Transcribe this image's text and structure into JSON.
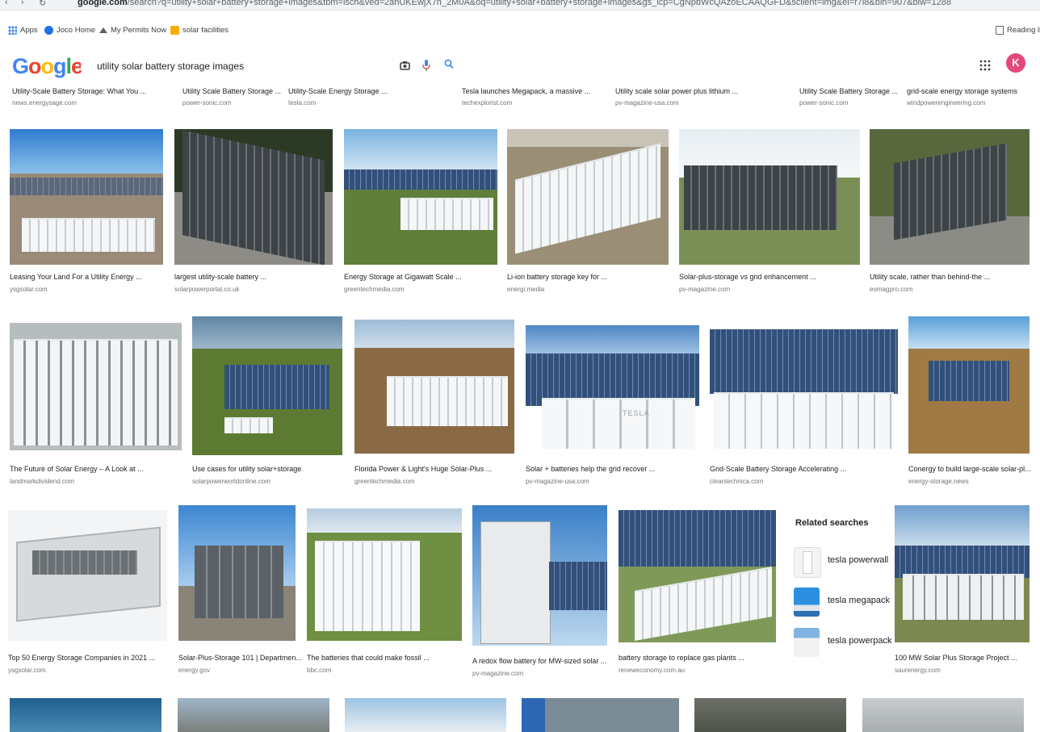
{
  "browser": {
    "url_domain": "google.com",
    "url_rest": "/search?q=utility+solar+battery+storage+images&tbm=isch&ved=2ahUKEwjX7h_2M0A&oq=utility+solar+battery+storage+images&gs_lcp=CgNpbWcQAzoECAAQGFD&sclient=img&ei=r7i8&bih=907&biw=1288",
    "back": "‹",
    "forward": "›",
    "reload": "↻"
  },
  "bookmarks": [
    {
      "label": "Apps",
      "color": "#4285f4"
    },
    {
      "label": "Joco Home",
      "color": "#1a73e8"
    },
    {
      "label": "My Permits Now",
      "color": "#5f6368"
    },
    {
      "label": "solar facilities",
      "color": "#f9ab00"
    }
  ],
  "reading_list": "Reading li",
  "search": {
    "logo_letters": [
      "G",
      "o",
      "o",
      "g",
      "l",
      "e"
    ],
    "logo_colors": [
      "#4285f4",
      "#ea4335",
      "#fbbc05",
      "#4285f4",
      "#34a853",
      "#ea4335"
    ],
    "query": "utility solar battery storage images"
  },
  "user_initial": "K",
  "top_row": [
    {
      "caption": "Utility-Scale Battery Storage: What You ...",
      "source": "news.energysage.com"
    },
    {
      "caption": "Utility Scale Battery Storage ...",
      "source": "power-sonic.com"
    },
    {
      "caption": "Utility-Scale Energy Storage ...",
      "source": "tesla.com"
    },
    {
      "caption": "Tesla launches Megapack, a massive ...",
      "source": "techexplorist.com"
    },
    {
      "caption": "Utility scale solar power plus lithium ...",
      "source": "pv-magazine-usa.com"
    },
    {
      "caption": "Utility Scale Battery Storage ...",
      "source": "power-sonic.com"
    },
    {
      "caption": "grid-scale energy storage systems",
      "source": "windpowerengineering.com"
    }
  ],
  "row1": [
    {
      "caption": "Leasing Your Land For a Utility Energy ...",
      "source": "ysgsolar.com"
    },
    {
      "caption": "largest utility-scale battery ...",
      "source": "solarpowerportal.co.uk"
    },
    {
      "caption": "Energy Storage at Gigawatt Scale ...",
      "source": "greentechmedia.com"
    },
    {
      "caption": "Li-ion battery storage key for ...",
      "source": "energi.media"
    },
    {
      "caption": "Solar-plus-storage vs grid enhancement ...",
      "source": "pv-magazine.com"
    },
    {
      "caption": "Utility scale, rather than behind-the ...",
      "source": "eomagpro.com"
    }
  ],
  "row2": [
    {
      "caption": "The Future of Solar Energy – A Look at ...",
      "source": "landmarkdividend.com"
    },
    {
      "caption": "Use cases for utility solar+storage",
      "source": "solarpowerworldonline.com"
    },
    {
      "caption": "Florida Power & Light's Huge Solar-Plus ...",
      "source": "greentechmedia.com"
    },
    {
      "caption": "Solar + batteries help the grid recover ...",
      "source": "pv-magazine-usa.com"
    },
    {
      "caption": "Grid-Scale Battery Storage Accelerating ...",
      "source": "cleantechnica.com"
    },
    {
      "caption": "Conergy to build large-scale solar-pl...",
      "source": "energy-storage.news"
    }
  ],
  "row3": [
    {
      "caption": "Top 50 Energy Storage Companies in 2021 ...",
      "source": "ysgsolar.com"
    },
    {
      "caption": "Solar-Plus-Storage 101 | Departmen...",
      "source": "energy.gov"
    },
    {
      "caption": "The batteries that could make fossil ...",
      "source": "bbc.com"
    },
    {
      "caption": "A redox flow battery for MW-sized solar ...",
      "source": "pv-magazine.com"
    },
    {
      "caption": "battery storage to replace gas plants ...",
      "source": "reneweconomy.com.au"
    },
    {
      "caption": "100 MW Solar Plus Storage Project ...",
      "source": "saurenergy.com"
    }
  ],
  "tesla_sign": "TESLA",
  "related": {
    "title": "Related searches",
    "items": [
      {
        "label": "tesla powerwall"
      },
      {
        "label": "tesla megapack"
      },
      {
        "label": "tesla powerpack"
      }
    ]
  }
}
